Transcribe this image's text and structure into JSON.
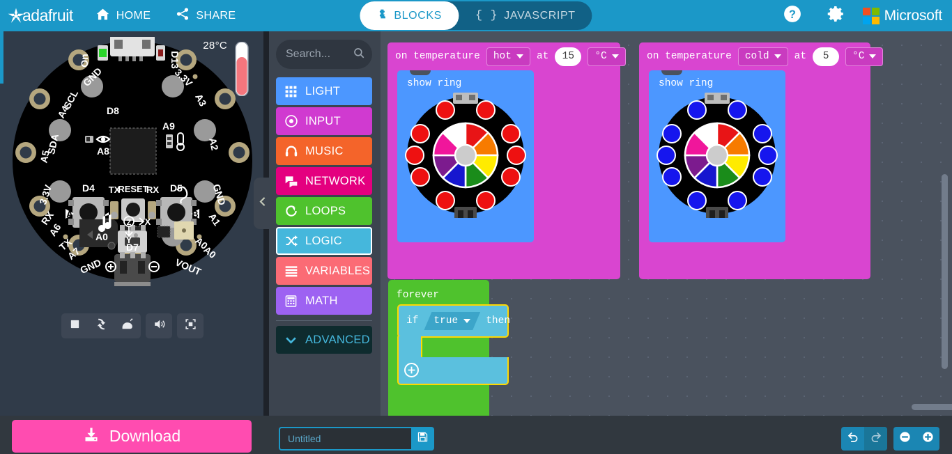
{
  "header": {
    "brand": "adafruit",
    "brand_icon": "adafruit-star-logo",
    "home_label": "HOME",
    "home_icon": "home-icon",
    "share_label": "SHARE",
    "share_icon": "share-icon",
    "tabs": [
      {
        "label": "BLOCKS",
        "icon": "puzzle-piece-icon",
        "active": true
      },
      {
        "label": "JAVASCRIPT",
        "icon": "curly-braces-icon",
        "active": false
      }
    ],
    "help_icon": "help-question-icon",
    "settings_icon": "gear-icon",
    "microsoft_label": "Microsoft",
    "microsoft_icon": "microsoft-logo",
    "bg_color": "#1b98c8"
  },
  "simulator": {
    "board_name": "circuit-playground-express",
    "temperature_label": "28°C",
    "temperature_value": 28,
    "temperature_unit": "°C",
    "board_pin_labels": [
      "On",
      "D13",
      "GND",
      "3.3V",
      "SCL",
      "A4",
      "A3",
      "SDA",
      "A5",
      "A2",
      "3.3V",
      "GND",
      "D8",
      "A8",
      "A9",
      "D4",
      "TX",
      "RESET",
      "RX",
      "D5",
      "A",
      "B",
      "RX",
      "A6",
      "A1",
      "TX",
      "A7",
      "A0",
      "D7",
      "GND",
      "VOUT",
      "A0"
    ],
    "controls": [
      {
        "name": "stop-button",
        "icon": "stop-square-icon"
      },
      {
        "name": "restart-button",
        "icon": "refresh-icon"
      },
      {
        "name": "slow-motion-button",
        "icon": "snail-icon"
      },
      {
        "name": "mute-button",
        "icon": "speaker-icon"
      },
      {
        "name": "fullscreen-button",
        "icon": "expand-icon"
      }
    ]
  },
  "toolbox": {
    "search_placeholder": "Search...",
    "search_value": "",
    "search_icon": "search-icon",
    "collapse_icon": "chevron-left-icon",
    "categories": [
      {
        "label": "LIGHT",
        "color": "#4c97ff",
        "icon": "grid-icon"
      },
      {
        "label": "INPUT",
        "color": "#d03ad0",
        "icon": "target-icon"
      },
      {
        "label": "MUSIC",
        "color": "#f4642a",
        "icon": "headphones-icon"
      },
      {
        "label": "NETWORK",
        "color": "#e4007f",
        "icon": "speech-bubbles-icon"
      },
      {
        "label": "LOOPS",
        "color": "#4fc22d",
        "icon": "loop-arrow-icon"
      },
      {
        "label": "LOGIC",
        "color": "#45b7dc",
        "icon": "shuffle-icon"
      },
      {
        "label": "VARIABLES",
        "color": "#fb6b75",
        "icon": "lines-icon"
      },
      {
        "label": "MATH",
        "color": "#9d62f2",
        "icon": "calculator-icon"
      }
    ],
    "advanced": {
      "label": "ADVANCED",
      "color": "#0e2b2e",
      "text_color": "#45b7dc",
      "icon": "chevron-down-icon"
    },
    "selected_category": "LOGIC"
  },
  "workspace": {
    "blocks": [
      {
        "kind": "event-hat",
        "name": "on-temperature-hot",
        "text_1": "on temperature",
        "condition": "hot",
        "text_2": "at",
        "value": "15",
        "unit": "°C",
        "color": "#d945d0",
        "child": {
          "kind": "show-ring",
          "label": "show ring",
          "color": "#4c97ff",
          "led_color": "#ee1111",
          "led_count": 10,
          "wheel_colors": [
            "#ffffff",
            "#e81416",
            "#f77b00",
            "#ffeb00",
            "#1a8c1a",
            "#1616cf",
            "#7c1b8e",
            "#f0169b"
          ],
          "wheel_center_color": "#cccccc"
        }
      },
      {
        "kind": "event-hat",
        "name": "on-temperature-cold",
        "text_1": "on temperature",
        "condition": "cold",
        "text_2": "at",
        "value": "5",
        "unit": "°C",
        "color": "#d945d0",
        "child": {
          "kind": "show-ring",
          "label": "show ring",
          "color": "#4c97ff",
          "led_color": "#1616ee",
          "led_count": 10,
          "wheel_colors": [
            "#ffffff",
            "#e81416",
            "#f77b00",
            "#ffeb00",
            "#1a8c1a",
            "#1616cf",
            "#7c1b8e",
            "#f0169b"
          ],
          "wheel_center_color": "#cccccc"
        }
      },
      {
        "kind": "forever",
        "name": "forever-loop",
        "label": "forever",
        "color": "#4fc22d",
        "child": {
          "kind": "if-then",
          "name": "if-then-block",
          "if_label": "if",
          "condition": "true",
          "then_label": "then",
          "add_icon": "plus-circle-icon",
          "color": "#5bc0de",
          "selected": true,
          "selection_color": "#ffd900"
        }
      }
    ],
    "hscroll": "horizontal-scrollbar",
    "vscroll": "vertical-scrollbar"
  },
  "bottom": {
    "download_label": "Download",
    "download_icon": "download-icon",
    "download_color": "#ff4cb0",
    "project_placeholder": "Untitled",
    "project_value": "",
    "save_icon": "floppy-save-icon",
    "undo_icon": "undo-arrow-icon",
    "redo_icon": "redo-arrow-icon",
    "zoom_out_icon": "minus-circle-icon",
    "zoom_in_icon": "plus-circle-icon"
  }
}
